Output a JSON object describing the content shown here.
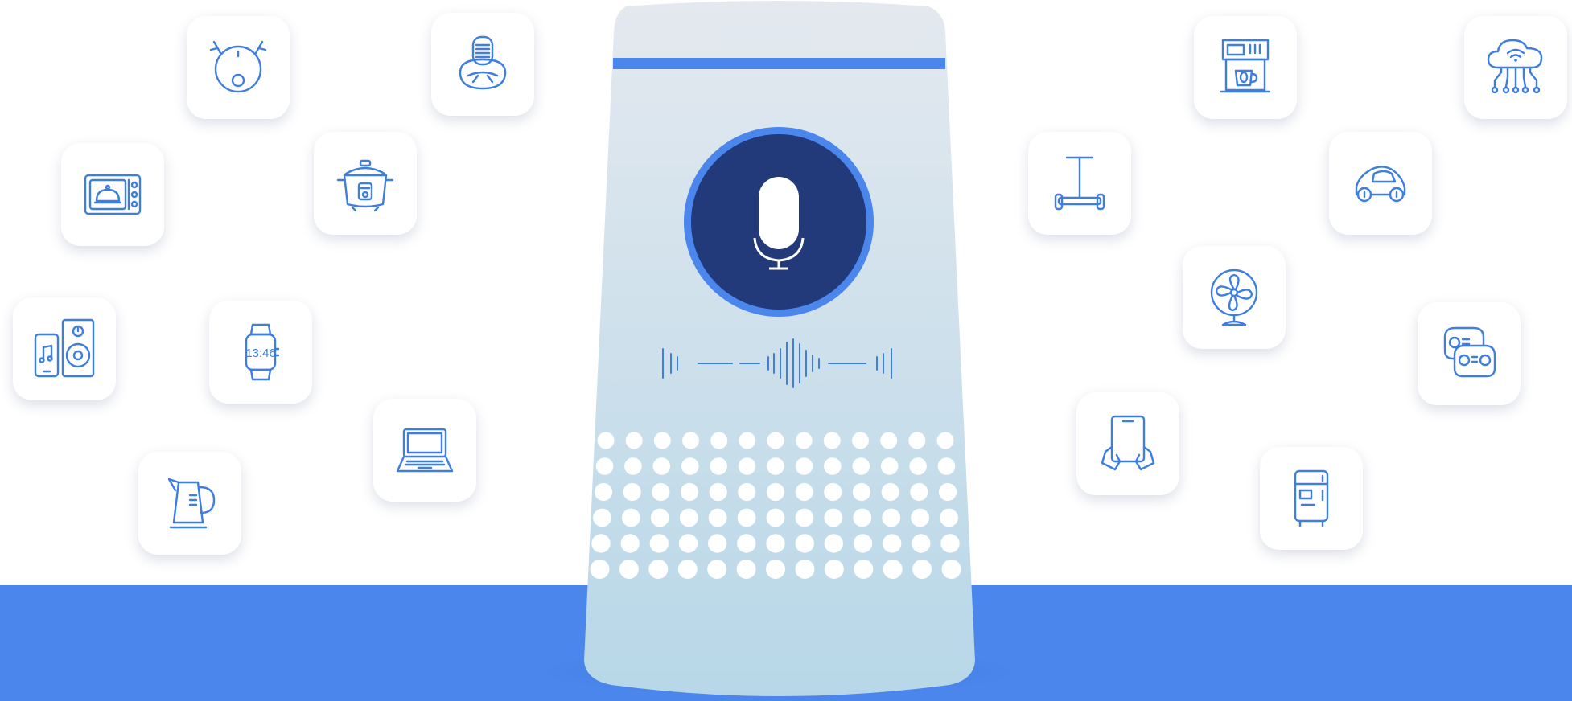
{
  "colors": {
    "accent": "#4a86ec",
    "icon_stroke": "#3d7ee0",
    "mic_circle": "#22397a",
    "speaker_top": "#e4e9ef",
    "speaker_bottom": "#b7d7e8"
  },
  "speaker": {
    "center_icon": "microphone-icon",
    "waveform": "sound-wave"
  },
  "devices_left": [
    "robot-vacuum-icon",
    "air-purifier-icon",
    "microwave-icon",
    "rice-cooker-icon",
    "phone-speaker-icon",
    "smartwatch-icon",
    "laptop-icon",
    "kettle-icon"
  ],
  "devices_right": [
    "coffee-machine-icon",
    "cloud-network-icon",
    "scooter-icon",
    "smart-car-icon",
    "fan-icon",
    "gamepad-icon",
    "tablet-icon",
    "refrigerator-icon"
  ],
  "watch_display": "13:46"
}
